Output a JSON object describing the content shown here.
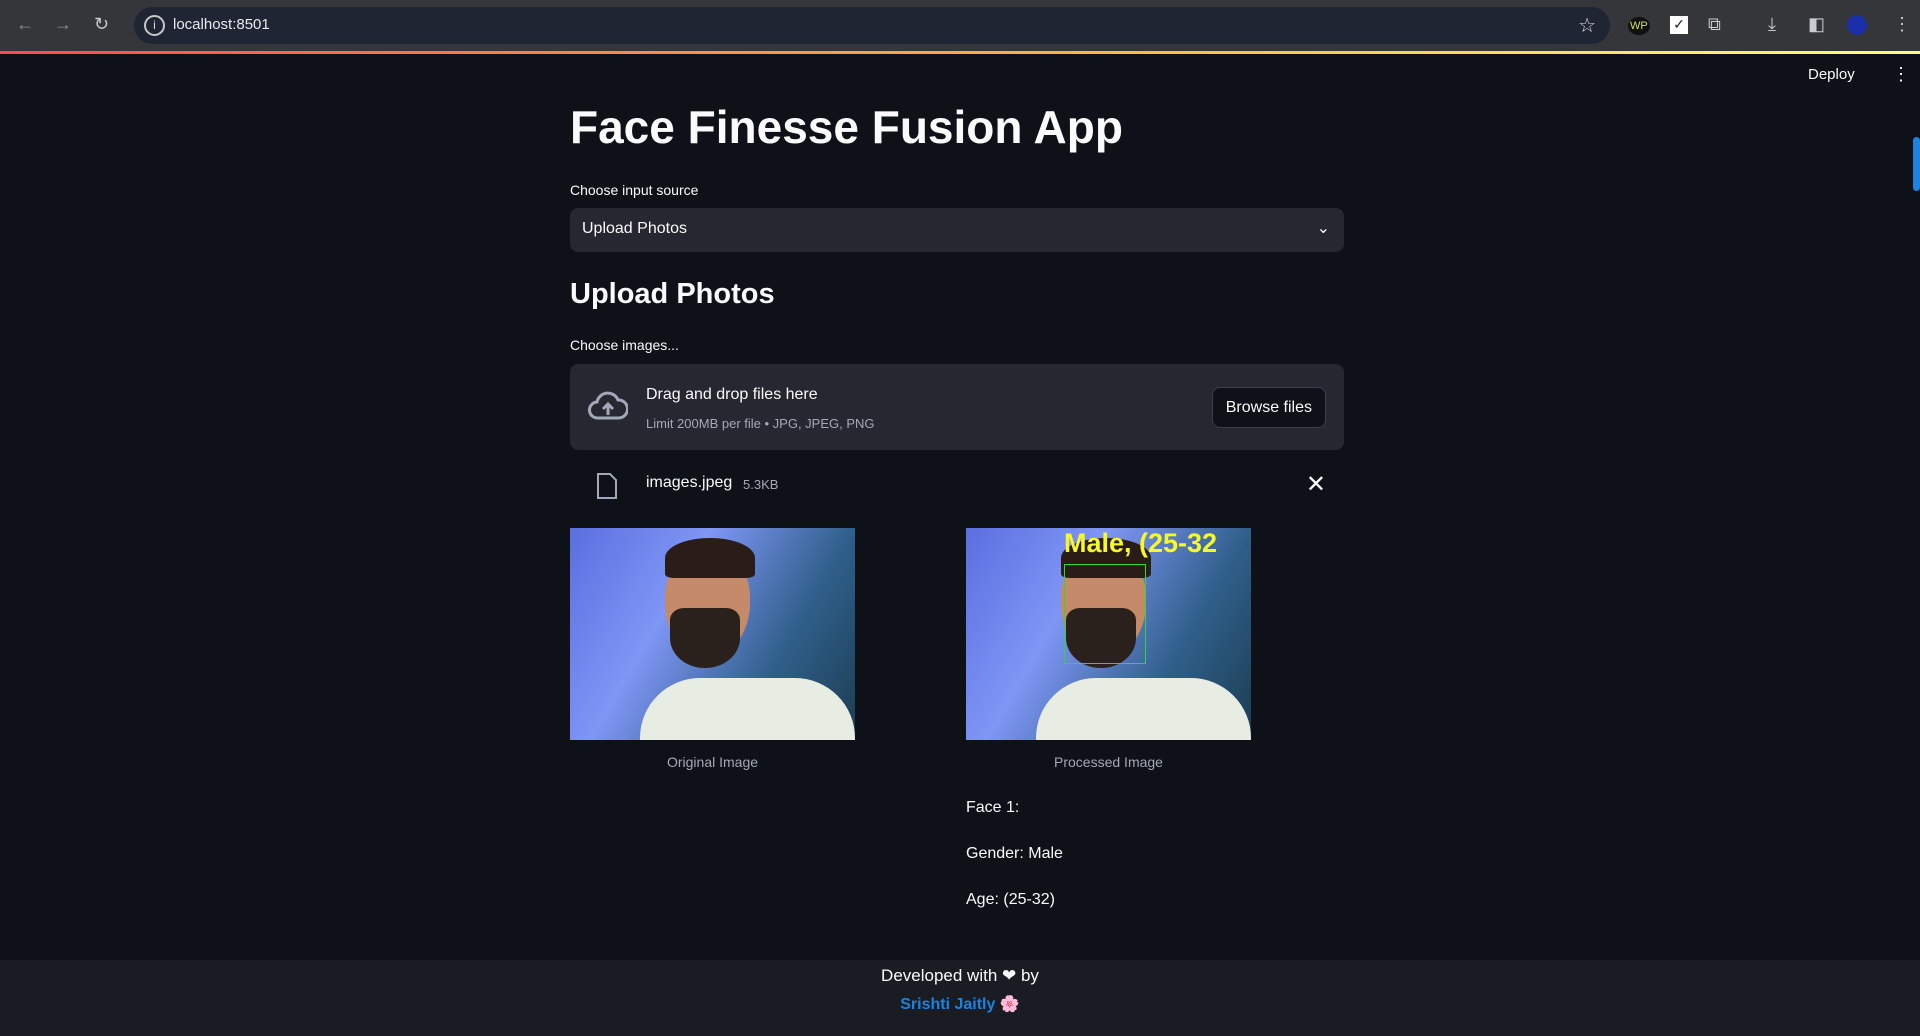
{
  "browser": {
    "url": "localhost:8501"
  },
  "header": {
    "deploy_label": "Deploy"
  },
  "main": {
    "title": "Face Finesse Fusion App",
    "source_label": "Choose input source",
    "source_value": "Upload Photos",
    "section_title": "Upload Photos",
    "uploader_label": "Choose images...",
    "drop_title": "Drag and drop files here",
    "drop_limit": "Limit 200MB per file • JPG, JPEG, PNG",
    "browse_label": "Browse files",
    "file": {
      "name": "images.jpeg",
      "size": "5.3KB"
    },
    "original_caption": "Original Image",
    "processed_caption": "Processed Image",
    "overlay_text": "Male, (25-32",
    "results": [
      "Face 1:",
      "Gender: Male",
      "Age: (25-32)"
    ]
  },
  "footer": {
    "line1": "Developed with ❤ by",
    "author": "Srishti Jaitly 🌸"
  },
  "colors": {
    "accent": "#1c83e1",
    "box": "#2cdc2c",
    "overlay": "#f7f72a",
    "background": "#0e1117"
  }
}
